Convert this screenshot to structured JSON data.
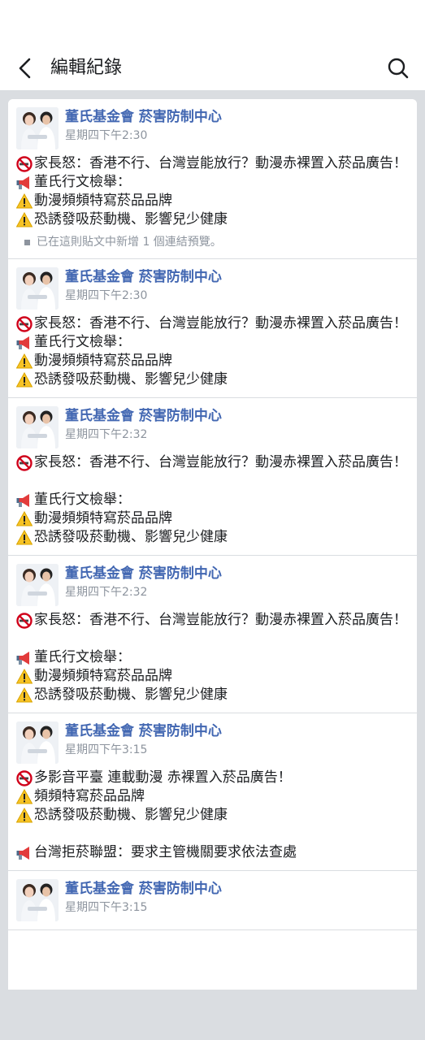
{
  "header": {
    "title": "編輯紀錄",
    "back_icon": "back-arrow-icon",
    "search_icon": "search-icon"
  },
  "page_name": "董氏基金會 菸害防制中心",
  "posts": [
    {
      "time": "星期四下午2:30",
      "lines": [
        {
          "icon": "no-smoking-icon",
          "text": "家長怒：香港不行、台灣豈能放行？動漫赤裸置入菸品廣告！"
        },
        {
          "icon": "megaphone-icon",
          "text": "董氏行文檢舉："
        },
        {
          "icon": "warning-icon",
          "text": "動漫頻頻特寫菸品品牌"
        },
        {
          "icon": "warning-icon",
          "text": "恐誘發吸菸動機、影響兒少健康"
        }
      ],
      "note": "已在這則貼文中新增 1 個連結預覽。"
    },
    {
      "time": "星期四下午2:30",
      "lines": [
        {
          "icon": "no-smoking-icon",
          "text": "家長怒：香港不行、台灣豈能放行？動漫赤裸置入菸品廣告！"
        },
        {
          "icon": "megaphone-icon",
          "text": "董氏行文檢舉："
        },
        {
          "icon": "warning-icon",
          "text": "動漫頻頻特寫菸品品牌"
        },
        {
          "icon": "warning-icon",
          "text": "恐誘發吸菸動機、影響兒少健康"
        }
      ]
    },
    {
      "time": "星期四下午2:32",
      "lines": [
        {
          "icon": "no-smoking-icon",
          "text": "家長怒：香港不行、台灣豈能放行？動漫赤裸置入菸品廣告！"
        },
        {
          "icon": "",
          "text": ""
        },
        {
          "icon": "megaphone-icon",
          "text": "董氏行文檢舉："
        },
        {
          "icon": "warning-icon",
          "text": "動漫頻頻特寫菸品品牌"
        },
        {
          "icon": "warning-icon",
          "text": "恐誘發吸菸動機、影響兒少健康"
        }
      ]
    },
    {
      "time": "星期四下午2:32",
      "lines": [
        {
          "icon": "no-smoking-icon",
          "text": "家長怒：香港不行、台灣豈能放行？動漫赤裸置入菸品廣告！"
        },
        {
          "icon": "",
          "text": ""
        },
        {
          "icon": "megaphone-icon",
          "text": "董氏行文檢舉："
        },
        {
          "icon": "warning-icon",
          "text": "動漫頻頻特寫菸品品牌"
        },
        {
          "icon": "warning-icon",
          "text": "恐誘發吸菸動機、影響兒少健康"
        }
      ]
    },
    {
      "time": "星期四下午3:15",
      "lines": [
        {
          "icon": "no-smoking-icon",
          "text": "多影音平臺 連載動漫 赤裸置入菸品廣告！"
        },
        {
          "icon": "warning-icon",
          "text": "頻頻特寫菸品品牌"
        },
        {
          "icon": "warning-icon",
          "text": "恐誘發吸菸動機、影響兒少健康"
        },
        {
          "icon": "",
          "text": ""
        },
        {
          "icon": "megaphone-icon",
          "text": "台灣拒菸聯盟：要求主管機關要求依法查處"
        }
      ]
    },
    {
      "time": "星期四下午3:15",
      "lines": []
    }
  ],
  "colors": {
    "page_name": "#4267b2",
    "timestamp": "#8d949e",
    "background": "#dadde1"
  }
}
